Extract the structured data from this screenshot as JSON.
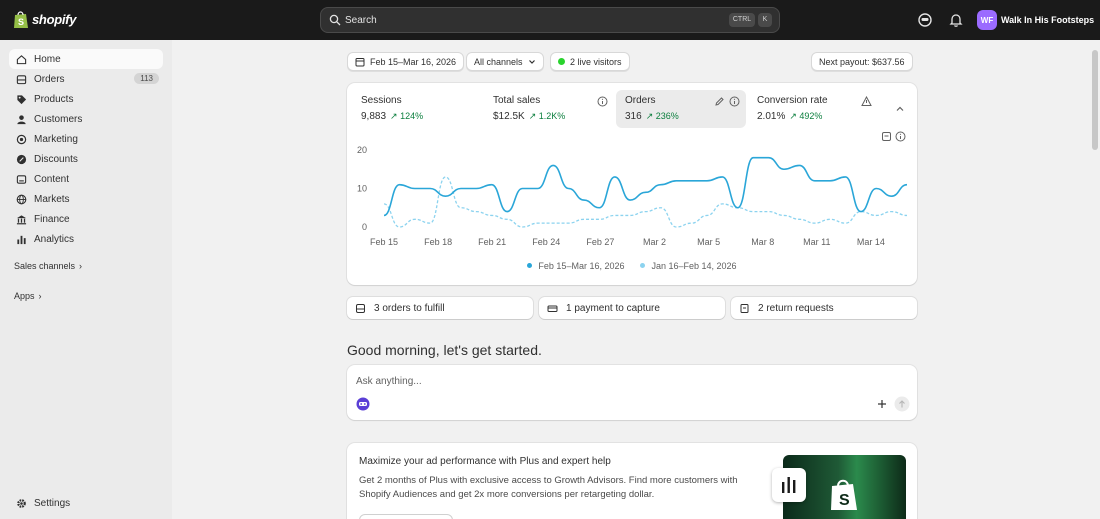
{
  "brand": {
    "logo_text": "shopify"
  },
  "search": {
    "label": "Search",
    "shortcut_ctrl": "CTRL",
    "shortcut_key": "K"
  },
  "store": {
    "initials": "WF",
    "name": "Walk In His Footsteps"
  },
  "sidebar": {
    "items": [
      {
        "label": "Home",
        "icon": "home-icon"
      },
      {
        "label": "Orders",
        "icon": "orders-icon",
        "badge": "113"
      },
      {
        "label": "Products",
        "icon": "tag-icon"
      },
      {
        "label": "Customers",
        "icon": "person-icon"
      },
      {
        "label": "Marketing",
        "icon": "target-icon"
      },
      {
        "label": "Discounts",
        "icon": "discount-icon"
      },
      {
        "label": "Content",
        "icon": "content-icon"
      },
      {
        "label": "Markets",
        "icon": "globe-icon"
      },
      {
        "label": "Finance",
        "icon": "bank-icon"
      },
      {
        "label": "Analytics",
        "icon": "bar-chart-icon"
      }
    ],
    "sales_channels": "Sales channels",
    "apps": "Apps",
    "settings": "Settings"
  },
  "filters": {
    "date_range": "Feb 15–Mar 16, 2026",
    "channels": "All channels",
    "live_visitors": "2 live visitors",
    "payout": "Next payout: $637.56"
  },
  "metrics": [
    {
      "title": "Sessions",
      "value": "9,883",
      "change": "124%"
    },
    {
      "title": "Total sales",
      "value": "$12.5K",
      "change": "1.2K%"
    },
    {
      "title": "Orders",
      "value": "316",
      "change": "236%"
    },
    {
      "title": "Conversion rate",
      "value": "2.01%",
      "change": "492%"
    }
  ],
  "chart_data": {
    "type": "line",
    "yticks": [
      "20",
      "10",
      "0"
    ],
    "ylim": [
      0,
      20
    ],
    "x_tick_labels": [
      "Feb 15",
      "Feb 18",
      "Feb 21",
      "Feb 24",
      "Feb 27",
      "Mar 2",
      "Mar 5",
      "Mar 8",
      "Mar 11",
      "Mar 14"
    ],
    "x_count": 30,
    "series": [
      {
        "name": "Feb 15–Mar 16, 2026",
        "color": "#2aa6d8",
        "values": [
          3,
          11,
          10,
          10,
          8,
          10,
          10,
          11,
          4,
          10,
          10,
          16,
          10,
          7,
          5,
          13,
          7,
          9,
          11,
          12,
          12,
          12,
          13,
          5,
          18,
          18,
          15,
          16,
          12,
          12,
          13,
          4,
          10,
          8,
          11
        ]
      },
      {
        "name": "Jan 16–Feb 14, 2026",
        "color": "#8cd3ef",
        "dashed": true,
        "values": [
          6,
          0,
          2,
          1,
          13,
          5,
          4,
          3,
          2,
          0,
          1,
          1,
          1,
          2,
          2,
          3,
          3,
          4,
          5,
          0,
          1,
          3,
          6,
          5,
          4,
          4,
          3,
          2,
          1,
          2,
          1,
          4,
          3,
          4,
          3
        ]
      }
    ]
  },
  "tasks": [
    {
      "label": "3 orders to fulfill",
      "icon": "inbox-icon"
    },
    {
      "label": "1 payment to capture",
      "icon": "payment-icon"
    },
    {
      "label": "2 return requests",
      "icon": "return-icon"
    }
  ],
  "greeting": "Good morning, let's get started.",
  "ask": {
    "placeholder": "Ask anything..."
  },
  "promo": {
    "title": "Maximize your ad performance with Plus and expert help",
    "text": "Get 2 months of Plus with exclusive access to Growth Advisors. Find more customers with Shopify Audiences and get 2x more conversions per retargeting dollar."
  }
}
